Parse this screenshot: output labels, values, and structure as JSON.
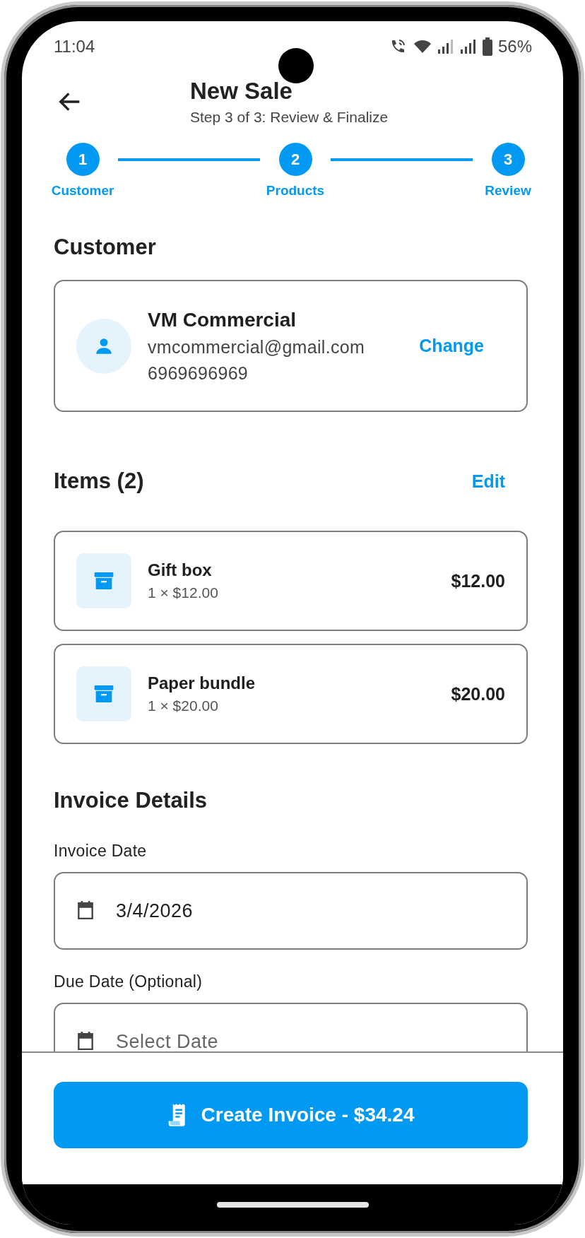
{
  "status_bar": {
    "time": "11:04",
    "battery": "56%"
  },
  "header": {
    "title": "New Sale",
    "subtitle": "Step 3 of 3: Review & Finalize"
  },
  "steps": [
    {
      "number": "1",
      "label": "Customer"
    },
    {
      "number": "2",
      "label": "Products"
    },
    {
      "number": "3",
      "label": "Review"
    }
  ],
  "customer": {
    "heading": "Customer",
    "name": "VM Commercial",
    "email": "vmcommercial@gmail.com",
    "phone": "6969696969",
    "action": "Change"
  },
  "items": {
    "heading": "Items (2)",
    "action": "Edit",
    "list": [
      {
        "name": "Gift box",
        "detail": "1 × $12.00",
        "price": "$12.00"
      },
      {
        "name": "Paper bundle",
        "detail": "1 × $20.00",
        "price": "$20.00"
      }
    ]
  },
  "invoice": {
    "heading": "Invoice Details",
    "fields": [
      {
        "label": "Invoice Date",
        "value": "3/4/2026"
      },
      {
        "label": "Due Date (Optional)",
        "placeholder": "Select Date"
      }
    ]
  },
  "submit_button": "Create Invoice - $34.24"
}
